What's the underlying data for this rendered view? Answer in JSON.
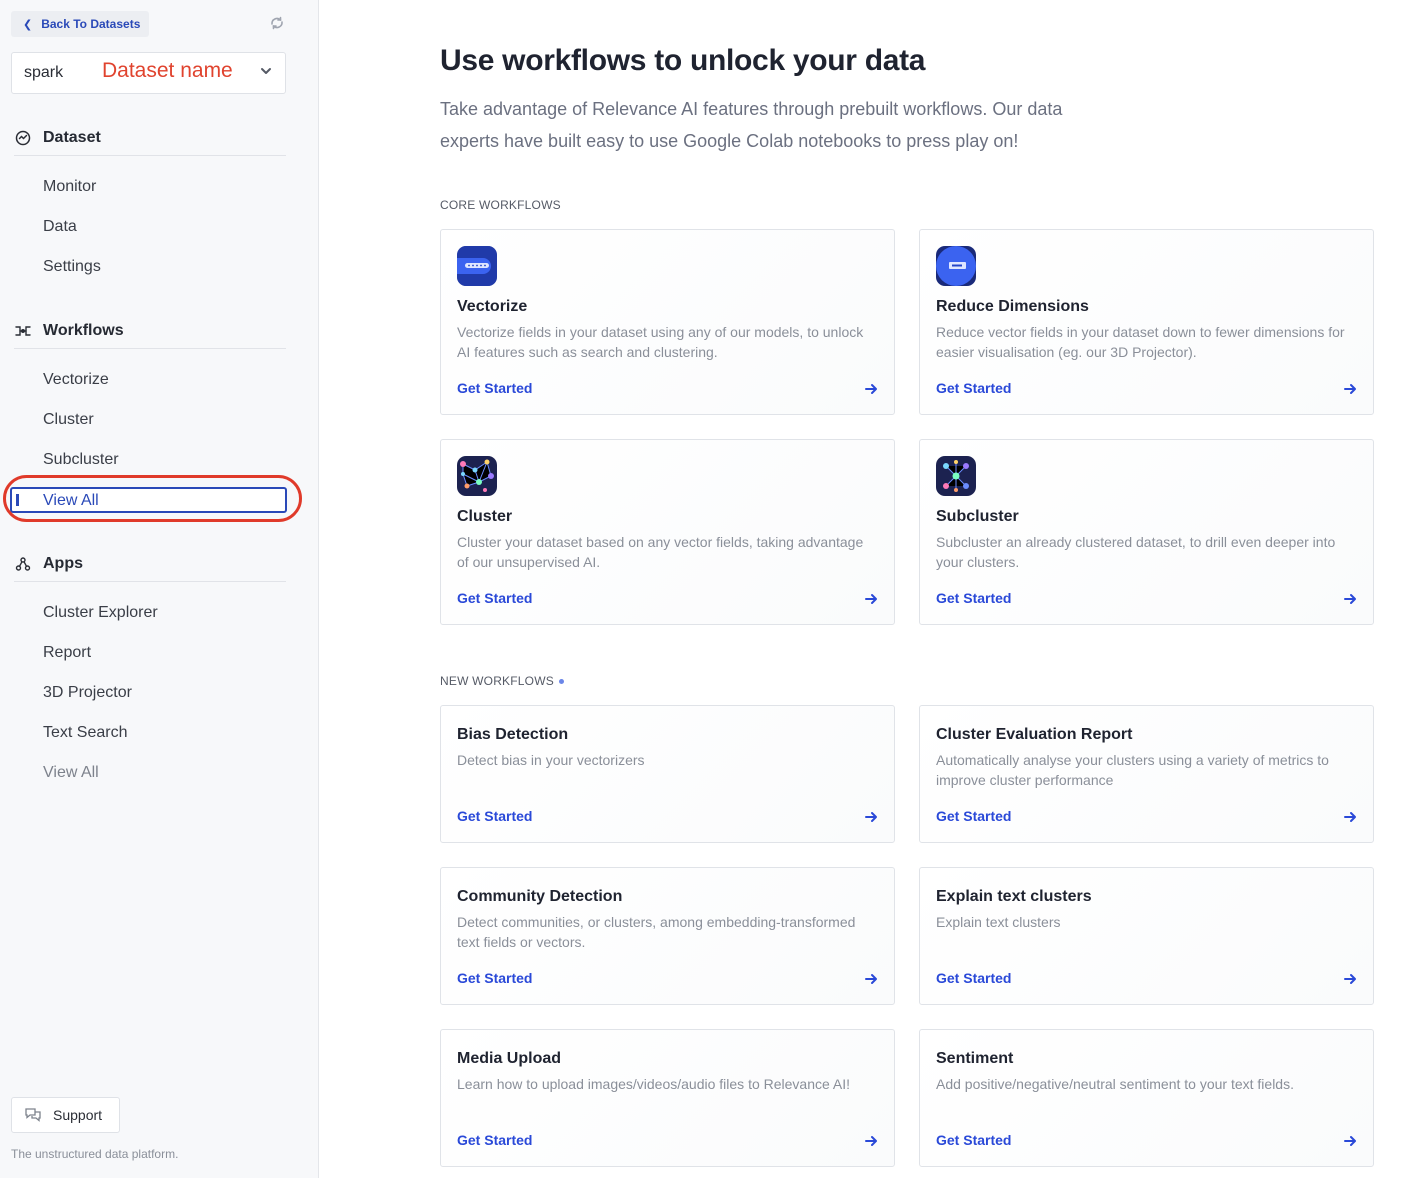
{
  "sidebar": {
    "back_label": "Back To Datasets",
    "dataset_value": "spark",
    "dataset_annotation": "Dataset name",
    "sections": {
      "dataset": {
        "title": "Dataset",
        "items": [
          "Monitor",
          "Data",
          "Settings"
        ]
      },
      "workflows": {
        "title": "Workflows",
        "items": [
          "Vectorize",
          "Cluster",
          "Subcluster"
        ],
        "active": "View All"
      },
      "apps": {
        "title": "Apps",
        "items": [
          "Cluster Explorer",
          "Report",
          "3D Projector",
          "Text Search"
        ],
        "more": "View All"
      }
    },
    "support_label": "Support",
    "tagline": "The unstructured data platform."
  },
  "main": {
    "title": "Use workflows to unlock your data",
    "subtitle": "Take advantage of Relevance AI features through prebuilt workflows. Our data experts have built easy to use Google Colab notebooks to press play on!",
    "core_label": "CORE WORKFLOWS",
    "new_label": "NEW WORKFLOWS",
    "cta": "Get Started",
    "core_cards": [
      {
        "title": "Vectorize",
        "desc": "Vectorize fields in your dataset using any of our models, to unlock AI features such as search and clustering.",
        "icon": "vectorize-icon"
      },
      {
        "title": "Reduce Dimensions",
        "desc": "Reduce vector fields in your dataset down to fewer dimensions for easier visualisation (eg. our 3D Projector).",
        "icon": "reduce-dimensions-icon"
      },
      {
        "title": "Cluster",
        "desc": "Cluster your dataset based on any vector fields, taking advantage of our unsupervised AI.",
        "icon": "cluster-icon"
      },
      {
        "title": "Subcluster",
        "desc": "Subcluster an already clustered dataset, to drill even deeper into your clusters.",
        "icon": "subcluster-icon"
      }
    ],
    "new_cards": [
      {
        "title": "Bias Detection",
        "desc": "Detect bias in your vectorizers"
      },
      {
        "title": "Cluster Evaluation Report",
        "desc": "Automatically analyse your clusters using a variety of metrics to improve cluster performance"
      },
      {
        "title": "Community Detection",
        "desc": "Detect communities, or clusters, among embedding-transformed text fields or vectors."
      },
      {
        "title": "Explain text clusters",
        "desc": "Explain text clusters"
      },
      {
        "title": "Media Upload",
        "desc": "Learn how to upload images/videos/audio files to Relevance AI!"
      },
      {
        "title": "Sentiment",
        "desc": "Add positive/negative/neutral sentiment to your text fields."
      }
    ]
  },
  "colors": {
    "accent": "#2a49d8",
    "annotation": "#e03a2a",
    "sidebar_bg": "#f7f8fa"
  }
}
